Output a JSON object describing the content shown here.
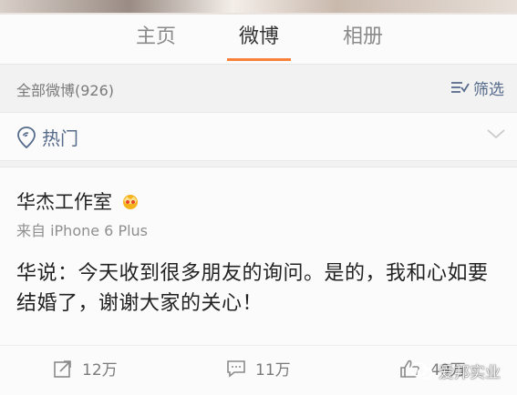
{
  "tabs": [
    {
      "label": "主页"
    },
    {
      "label": "微博"
    },
    {
      "label": "相册"
    }
  ],
  "active_tab": "微博",
  "feed": {
    "count_label": "全部微博(926)",
    "filter_label": "筛选"
  },
  "hot": {
    "label": "热门"
  },
  "post": {
    "author": "华杰工作室",
    "source": "来自 iPhone 6 Plus",
    "text": "华说：今天收到很多朋友的询问。是的，我和心如要结婚了，谢谢大家的关心！",
    "reposts": "12万",
    "comments": "11万",
    "likes": "49万"
  },
  "watermark": {
    "text": "爱邦实业"
  },
  "colors": {
    "accent": "#f8813c",
    "link_blue": "#566b8c"
  }
}
